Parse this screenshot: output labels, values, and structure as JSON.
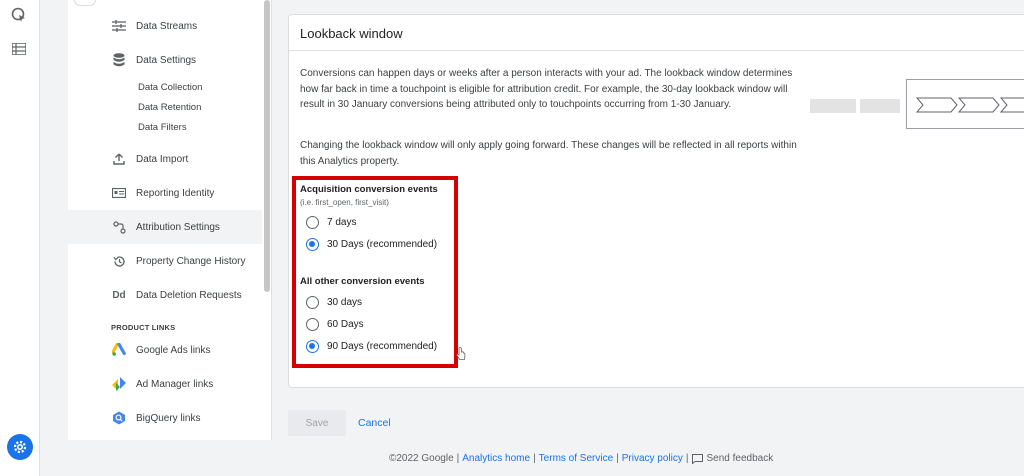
{
  "sidebar": {
    "items": [
      {
        "label": "Data Streams",
        "icon": "data-streams-icon"
      },
      {
        "label": "Data Settings",
        "icon": "database-icon"
      },
      {
        "label": "Data Import",
        "icon": "upload-icon"
      },
      {
        "label": "Reporting Identity",
        "icon": "reporting-identity-icon"
      },
      {
        "label": "Attribution Settings",
        "icon": "attribution-icon"
      },
      {
        "label": "Property Change History",
        "icon": "history-icon"
      },
      {
        "label": "Data Deletion Requests",
        "icon": "data-deletion-icon"
      }
    ],
    "sub_items": [
      "Data Collection",
      "Data Retention",
      "Data Filters"
    ],
    "product_links_header": "PRODUCT LINKS",
    "product_links": [
      {
        "label": "Google Ads links",
        "icon": "google-ads-icon"
      },
      {
        "label": "Ad Manager links",
        "icon": "ad-manager-icon"
      },
      {
        "label": "BigQuery links",
        "icon": "bigquery-icon"
      }
    ]
  },
  "card": {
    "title": "Lookback window",
    "para1": "Conversions can happen days or weeks after a person interacts with your ad. The lookback window determines how far back in time a touchpoint is eligible for attribution credit. For example, the 30-day lookback window will result in 30 January conversions being attributed only to touchpoints occurring from 1-30 January.",
    "para2": "Changing the lookback window will only apply going forward. These changes will be reflected in all reports within this Analytics property.",
    "acquisition": {
      "title": "Acquisition conversion events",
      "subtitle": "(i.e. first_open, first_visit)",
      "options": [
        "7 days",
        "30 Days (recommended)"
      ],
      "selected": "30 Days (recommended)"
    },
    "other": {
      "title": "All other conversion events",
      "options": [
        "30 days",
        "60 Days",
        "90 Days (recommended)"
      ],
      "selected": "90 Days (recommended)"
    }
  },
  "actions": {
    "save": "Save",
    "cancel": "Cancel"
  },
  "footer": {
    "copyright": "©2022 Google",
    "analytics_home": "Analytics home",
    "terms": "Terms of Service",
    "privacy": "Privacy policy",
    "feedback": "Send feedback"
  },
  "colors": {
    "accent": "#1a73e8",
    "highlight": "#d50000"
  }
}
